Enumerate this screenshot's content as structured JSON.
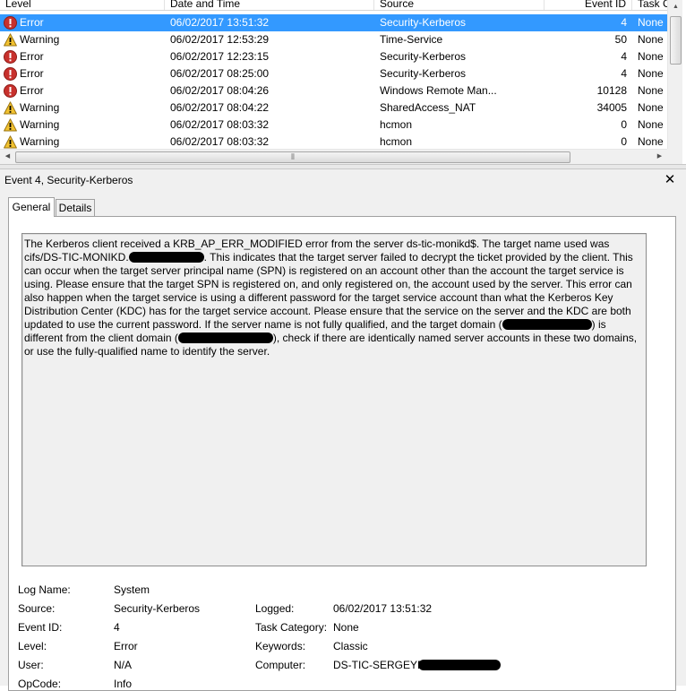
{
  "columns": {
    "level": "Level",
    "date": "Date and Time",
    "source": "Source",
    "event_id": "Event ID",
    "task": "Task C"
  },
  "rows": [
    {
      "level": "Error",
      "date": "06/02/2017 13:51:32",
      "source": "Security-Kerberos",
      "event_id": "4",
      "task": "None",
      "icon": "error-icon",
      "selected": true
    },
    {
      "level": "Warning",
      "date": "06/02/2017 12:53:29",
      "source": "Time-Service",
      "event_id": "50",
      "task": "None",
      "icon": "warning-icon"
    },
    {
      "level": "Error",
      "date": "06/02/2017 12:23:15",
      "source": "Security-Kerberos",
      "event_id": "4",
      "task": "None",
      "icon": "error-icon"
    },
    {
      "level": "Error",
      "date": "06/02/2017 08:25:00",
      "source": "Security-Kerberos",
      "event_id": "4",
      "task": "None",
      "icon": "error-icon"
    },
    {
      "level": "Error",
      "date": "06/02/2017 08:04:26",
      "source": "Windows Remote Man...",
      "event_id": "10128",
      "task": "None",
      "icon": "error-icon"
    },
    {
      "level": "Warning",
      "date": "06/02/2017 08:04:22",
      "source": "SharedAccess_NAT",
      "event_id": "34005",
      "task": "None",
      "icon": "warning-icon"
    },
    {
      "level": "Warning",
      "date": "06/02/2017 08:03:32",
      "source": "hcmon",
      "event_id": "0",
      "task": "None",
      "icon": "warning-icon"
    },
    {
      "level": "Warning",
      "date": "06/02/2017 08:03:32",
      "source": "hcmon",
      "event_id": "0",
      "task": "None",
      "icon": "warning-icon"
    }
  ],
  "colors": {
    "selection": "#3399ff",
    "error": "#c8312d",
    "warning": "#f2c230"
  },
  "detail": {
    "title": "Event 4, Security-Kerberos",
    "close": "✕",
    "tabs": {
      "general": "General",
      "details": "Details"
    },
    "description": {
      "p1": "The Kerberos client received a KRB_AP_ERR_MODIFIED error from the server ds-tic-monikd$. The target name used was cifs/DS-TIC-MONIKD.",
      "p2": ". This indicates that the target server failed to decrypt the ticket provided by the client. This can occur when the target server principal name (SPN) is registered on an account other than the account the target service is using. Please ensure that the target SPN is registered on, and only registered on, the account used by the server. This error can also happen when the target service is using a different password for the target service account than what the Kerberos Key Distribution Center (KDC) has for the target service account. Please ensure that the service on the server and the KDC are both updated to use the current password. If the server name is not fully qualified, and the target domain (",
      "p3": ") is different from the client domain (",
      "p4": "), check if there are identically named server accounts in these two domains, or use the fully-qualified name to identify the server."
    },
    "properties": {
      "log_name_label": "Log Name:",
      "log_name": "System",
      "source_label": "Source:",
      "source": "Security-Kerberos",
      "logged_label": "Logged:",
      "logged": "06/02/2017 13:51:32",
      "event_id_label": "Event ID:",
      "event_id": "4",
      "task_category_label": "Task Category:",
      "task_category": "None",
      "level_label": "Level:",
      "level": "Error",
      "keywords_label": "Keywords:",
      "keywords": "Classic",
      "user_label": "User:",
      "user": "N/A",
      "computer_label": "Computer:",
      "computer": "DS-TIC-SERGEYF",
      "opcode_label": "OpCode:",
      "opcode": "Info"
    }
  }
}
